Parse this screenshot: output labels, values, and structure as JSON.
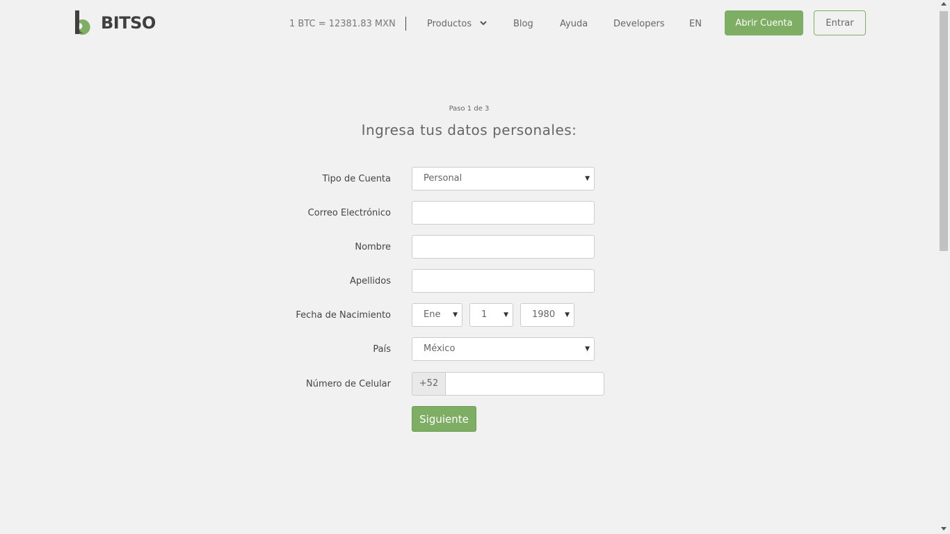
{
  "header": {
    "brand": "BITSO",
    "price_ticker": "1 BTC = 12381.83 MXN",
    "nav": {
      "productos": "Productos",
      "blog": "Blog",
      "ayuda": "Ayuda",
      "developers": "Developers",
      "language": "EN"
    },
    "open_account": "Abrir Cuenta",
    "login": "Entrar"
  },
  "form": {
    "step": "Paso 1 de 3",
    "title": "Ingresa tus datos personales:",
    "account_type": {
      "label": "Tipo de Cuenta",
      "value": "Personal"
    },
    "email": {
      "label": "Correo Electrónico",
      "value": ""
    },
    "first_name": {
      "label": "Nombre",
      "value": ""
    },
    "last_name": {
      "label": "Apellidos",
      "value": ""
    },
    "birth_date": {
      "label": "Fecha de Nacimiento",
      "month": "Ene",
      "day": "1",
      "year": "1980"
    },
    "country": {
      "label": "País",
      "value": "México"
    },
    "phone": {
      "label": "Número de Celular",
      "prefix": "+52",
      "value": ""
    },
    "next_button": "Siguiente"
  },
  "colors": {
    "accent": "#7eae64",
    "background": "#f0f1f0"
  },
  "icons": {
    "dropdown": "chevron-down-icon",
    "select": "caret-down-icon"
  }
}
